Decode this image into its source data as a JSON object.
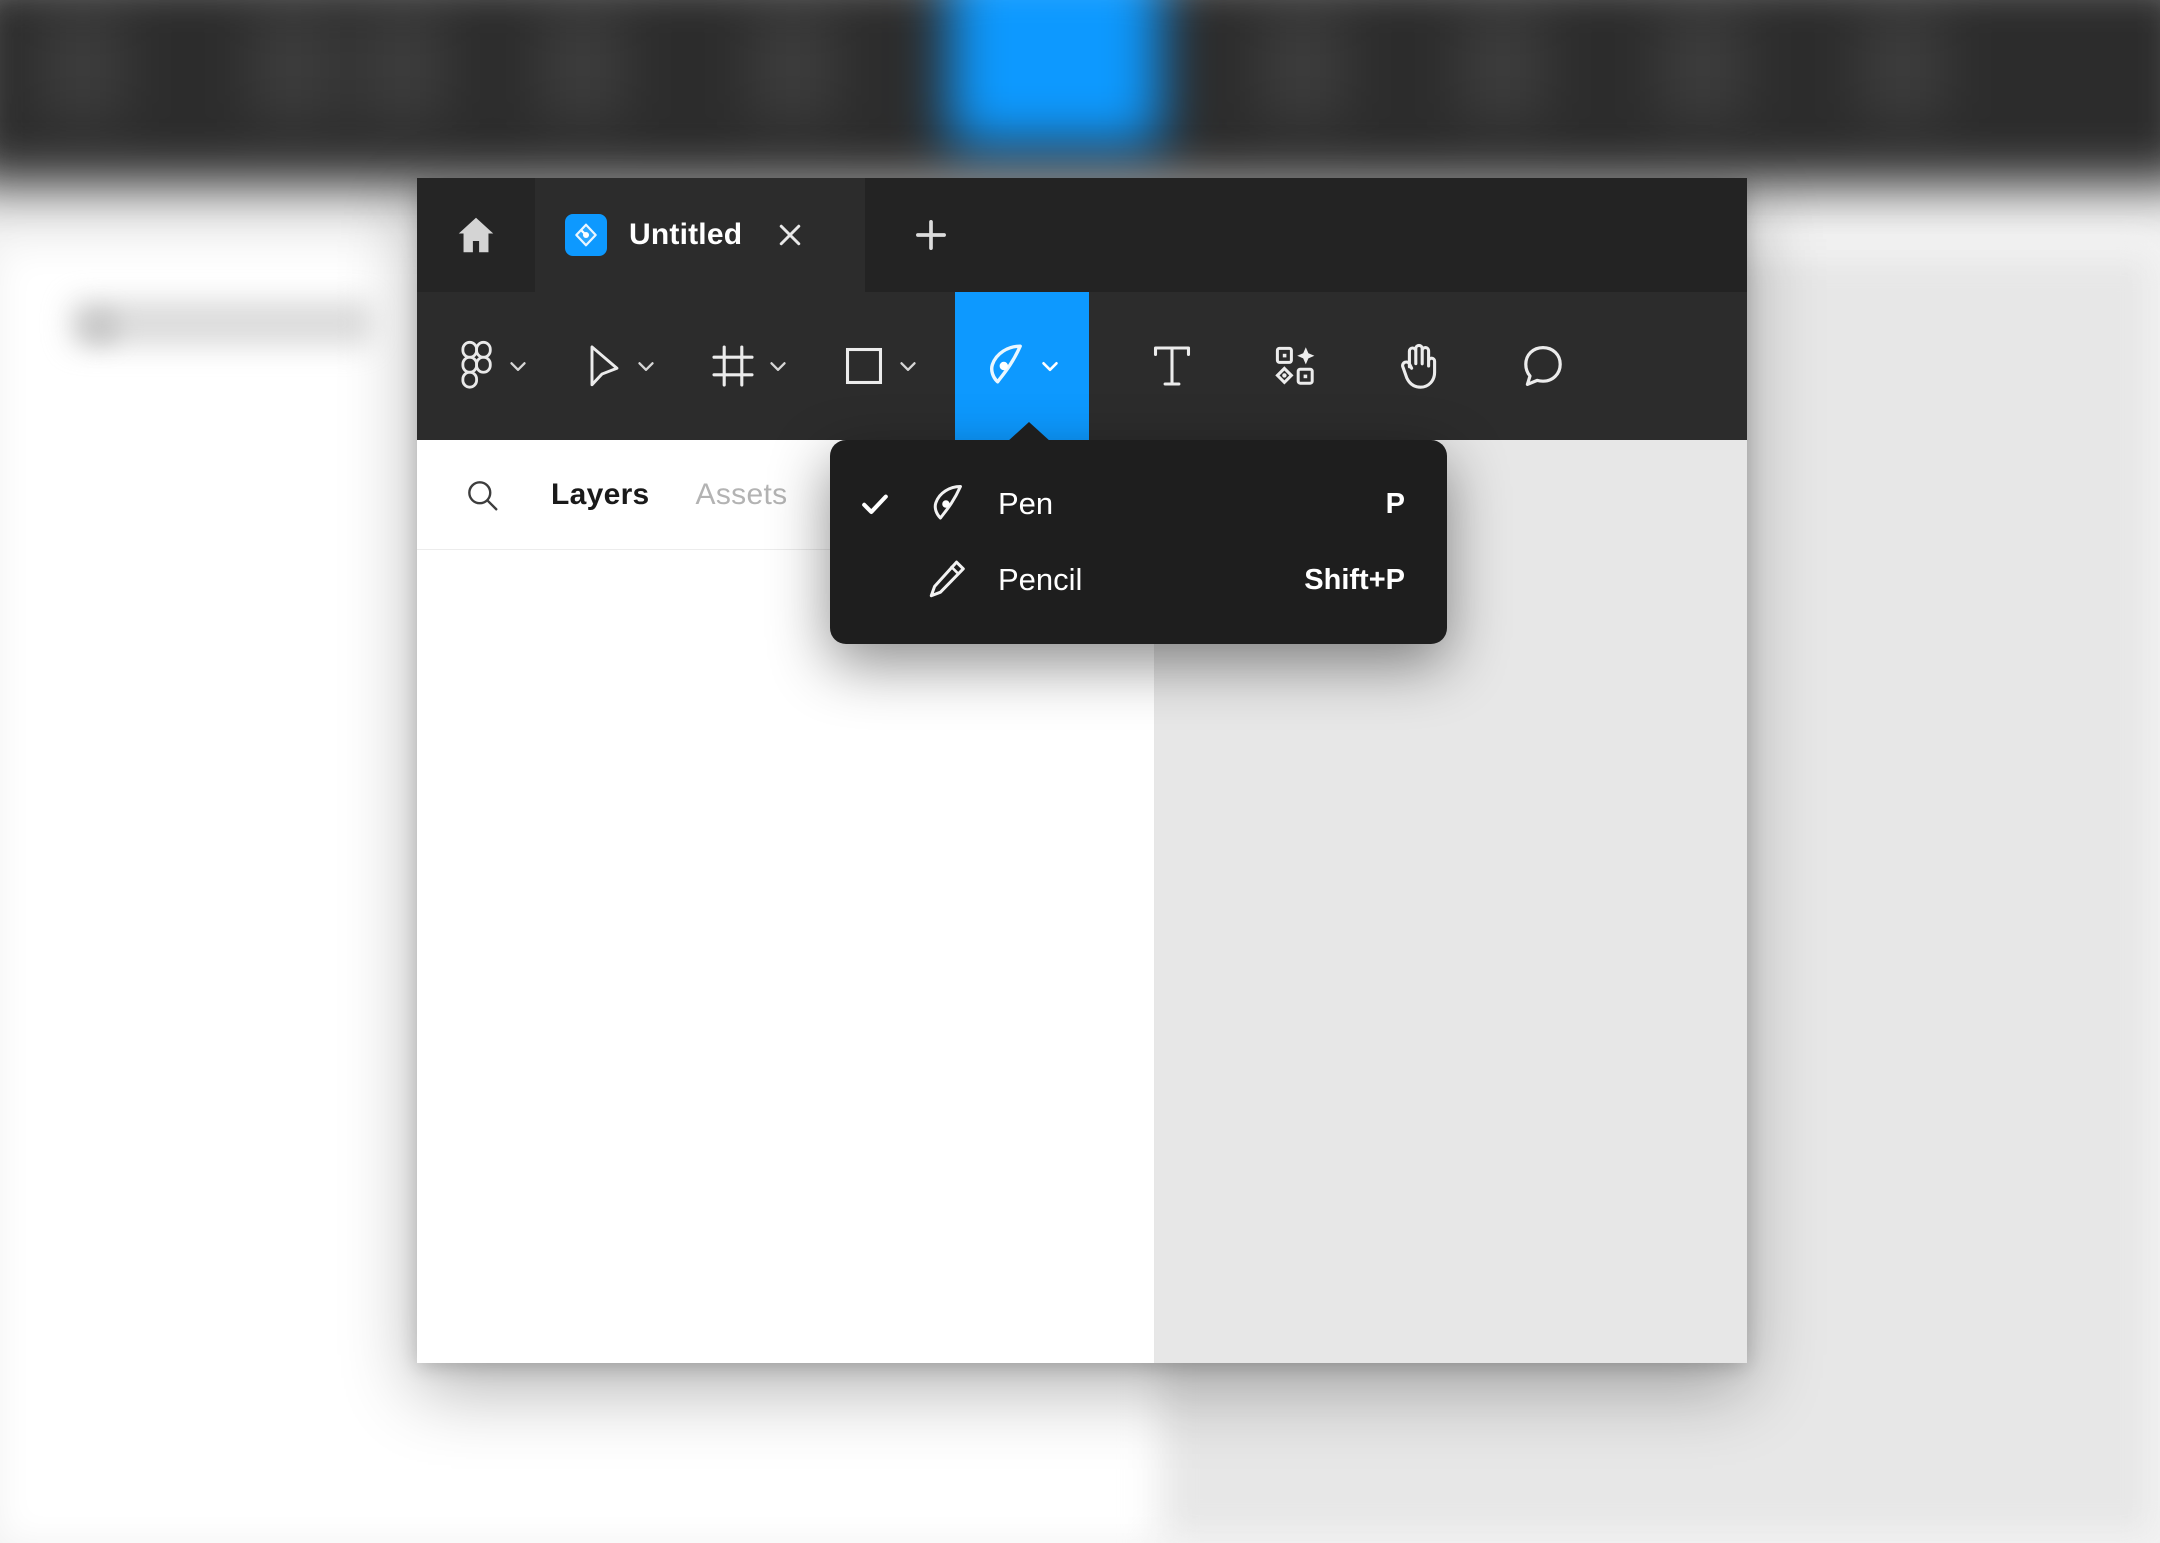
{
  "background": {
    "description": "blurred design application toolbar",
    "accent_color": "#0D99FF",
    "toolbar_color": "#2C2C2C"
  },
  "window": {
    "tabbar": {
      "home_button": {
        "icon": "home-icon",
        "label": "Home"
      },
      "tab": {
        "file_icon": "figma-file-icon",
        "title": "Untitled",
        "close_icon": "close-icon"
      },
      "new_tab_button": {
        "icon": "plus-icon",
        "label": "New tab"
      }
    },
    "toolbar": {
      "active_tool": "pen",
      "accent_color": "#0D99FF",
      "tools": [
        {
          "name": "main-menu",
          "icon": "figma-logo-icon",
          "has_chevron": true,
          "active": false
        },
        {
          "name": "move",
          "icon": "cursor-arrow-icon",
          "has_chevron": true,
          "active": false
        },
        {
          "name": "frame",
          "icon": "frame-icon",
          "has_chevron": true,
          "active": false
        },
        {
          "name": "shape",
          "icon": "rectangle-icon",
          "has_chevron": true,
          "active": false
        },
        {
          "name": "pen",
          "icon": "pen-nib-icon",
          "has_chevron": true,
          "active": true
        },
        {
          "name": "text",
          "icon": "text-t-icon",
          "has_chevron": false,
          "active": false
        },
        {
          "name": "actions",
          "icon": "actions-sparkle-icon",
          "has_chevron": false,
          "active": false
        },
        {
          "name": "hand",
          "icon": "hand-icon",
          "has_chevron": false,
          "active": false
        },
        {
          "name": "comment",
          "icon": "comment-bubble-icon",
          "has_chevron": false,
          "active": false
        }
      ]
    },
    "dropdown": {
      "title": "Pen tool options",
      "items": [
        {
          "label": "Pen",
          "shortcut": "P",
          "icon": "pen-nib-icon",
          "checked": true
        },
        {
          "label": "Pencil",
          "shortcut": "Shift+P",
          "icon": "pencil-icon",
          "checked": false
        }
      ]
    },
    "sidebar": {
      "search": {
        "icon": "search-icon",
        "placeholder": "Search"
      },
      "tabs": [
        {
          "label": "Layers",
          "active": true
        },
        {
          "label": "Assets",
          "active": false
        }
      ]
    },
    "canvas": {
      "background_color": "#E7E7E7"
    }
  }
}
